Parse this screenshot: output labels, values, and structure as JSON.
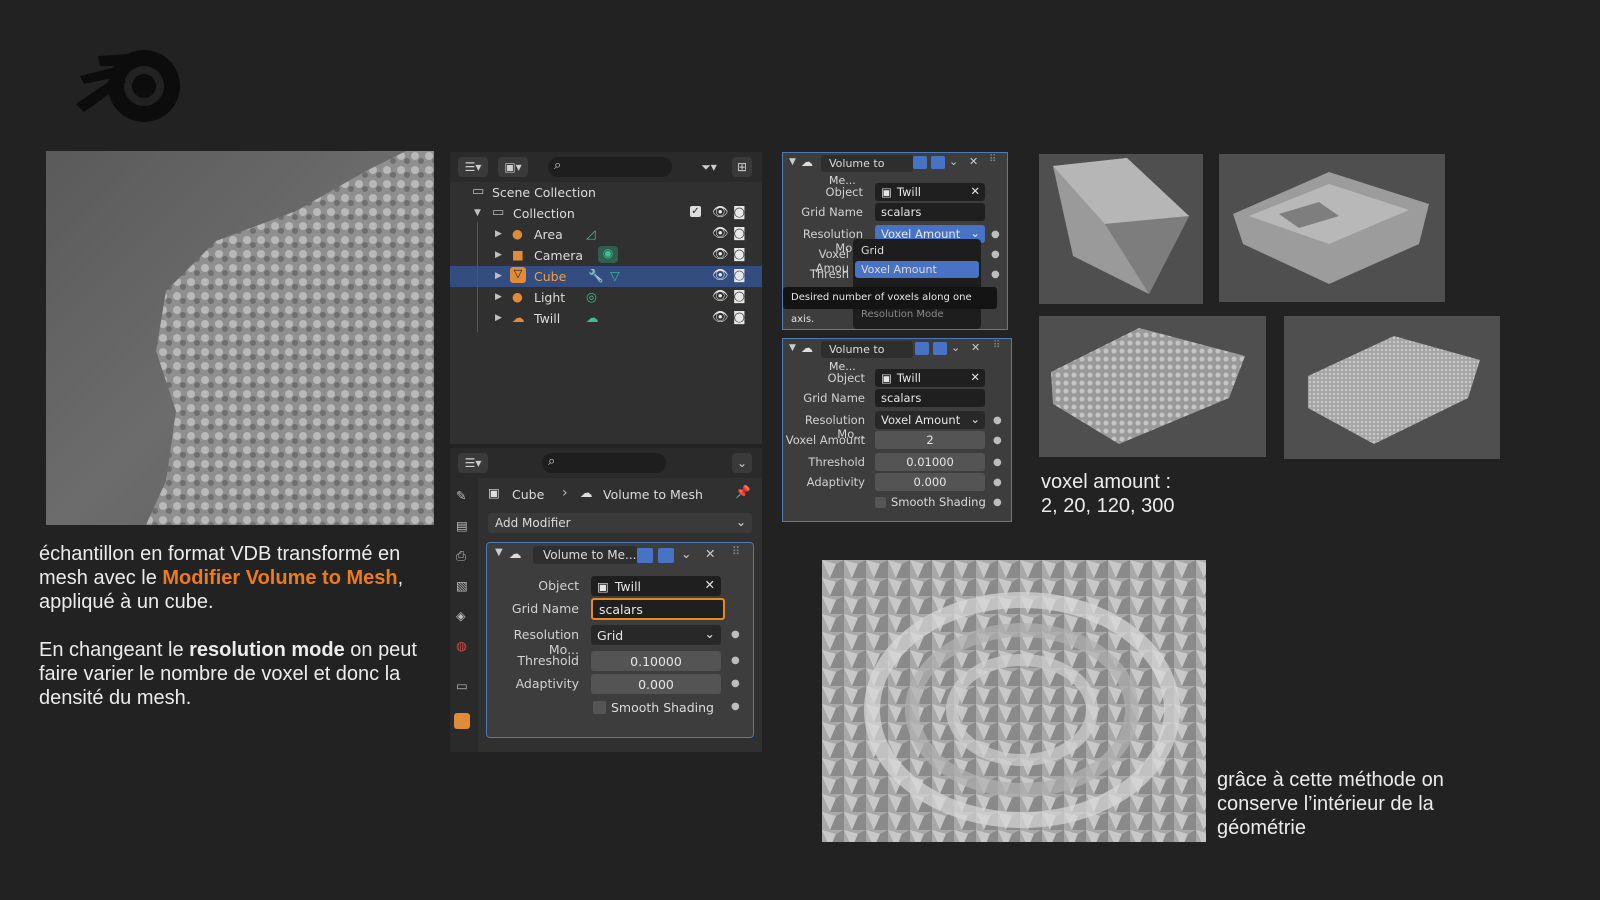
{
  "left_text": {
    "part1": "échantillon en format VDB transformé en mesh avec le ",
    "highlight": "Modifier Volume to Mesh",
    "part2": ", appliqué à un cube.",
    "p2_part1": "En changeant le ",
    "p2_bold": "resolution mode",
    "p2_part2": " on peut faire varier le nombre de voxel et donc la densité du mesh."
  },
  "voxel_caption": {
    "line1": "voxel amount :",
    "line2": "2, 20, 120, 300"
  },
  "bottom_caption": "grâce à cette méthode on conserve l’intérieur de la géométrie",
  "outliner": {
    "scene_collection": "Scene Collection",
    "collection": "Collection",
    "items": [
      {
        "label": "Area"
      },
      {
        "label": "Camera"
      },
      {
        "label": "Cube"
      },
      {
        "label": "Light"
      },
      {
        "label": "Twill"
      }
    ]
  },
  "properties": {
    "breadcrumb_object": "Cube",
    "breadcrumb_sep": "›",
    "breadcrumb_modifier": "Volume to Mesh",
    "add_modifier": "Add Modifier",
    "modifier": {
      "name": "Volume to Me...",
      "object_label": "Object",
      "object_value": "Twill",
      "grid_label": "Grid Name",
      "grid_value": "scalars",
      "res_label": "Resolution Mo...",
      "res_value": "Grid",
      "threshold_label": "Threshold",
      "threshold_value": "0.10000",
      "adaptivity_label": "Adaptivity",
      "adaptivity_value": "0.000",
      "smooth_label": "Smooth Shading"
    }
  },
  "mod_top": {
    "name": "Volume to Me...",
    "object_label": "Object",
    "object_value": "Twill",
    "grid_label": "Grid Name",
    "grid_value": "scalars",
    "res_label": "Resolution Mo...",
    "res_value": "Voxel Amount",
    "voxel_label": "Voxel Amou",
    "threshold_label": "Thresh",
    "menu_grid": "Grid",
    "menu_voxel": "Voxel Amount",
    "tooltip": "Desired number of voxels along one axis.",
    "tooltip_sub": "Resolution Mode"
  },
  "mod_mid": {
    "name": "Volume to Me...",
    "object_label": "Object",
    "object_value": "Twill",
    "grid_label": "Grid Name",
    "grid_value": "scalars",
    "res_label": "Resolution Mo...",
    "res_value": "Voxel Amount",
    "voxel_label": "Voxel Amount",
    "voxel_value": "2",
    "threshold_label": "Threshold",
    "threshold_value": "0.01000",
    "adaptivity_label": "Adaptivity",
    "adaptivity_value": "0.000",
    "smooth_label": "Smooth Shading"
  },
  "colors": {
    "background": "#222222",
    "accent": "#ec7b1f",
    "selection": "#334d80",
    "panel": "#303030"
  }
}
